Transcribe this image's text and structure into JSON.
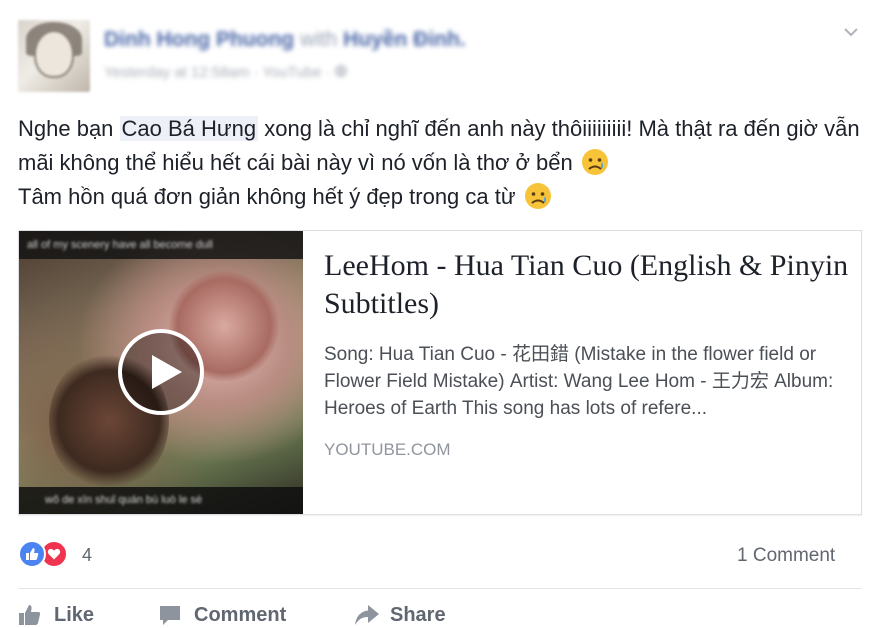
{
  "header": {
    "author": "Dinh Hong Phuong",
    "with_label": "with",
    "tagged": "Huyền Đinh.",
    "timestamp": "Yesterday at 12:58am",
    "source": "YouTube",
    "privacy_icon": "globe-icon",
    "menu_icon": "chevron-down-icon"
  },
  "post": {
    "text_before_mention": "Nghe bạn ",
    "mention": "Cao Bá Hưng",
    "text_line1_rest": " xong là chỉ nghĩ đến anh này thôiiiiiiiii! Mà thật ra đến giờ vẫn mãi không thể hiểu hết cái bài này vì nó vốn là thơ ở bển",
    "text_line2": "Tâm hồn quá đơn giản không hết ý đẹp trong ca từ",
    "emoji": "sad-tear-emoji"
  },
  "link_preview": {
    "thumb_caption_top": "all of my scenery have all become dull",
    "thumb_caption_bottom": "wǒ de xīn shuǐ quán bù luò le sè",
    "title": "LeeHom - Hua Tian Cuo (English & Pinyin Subtitles)",
    "description": "Song: Hua Tian Cuo - 花田錯 (Mistake in the flower field or Flower Field Mistake) Artist: Wang Lee Hom - 王力宏 Album: Heroes of Earth This song has lots of refere...",
    "domain": "YOUTUBE.COM",
    "play_icon": "play-icon"
  },
  "stats": {
    "reaction_count": "4",
    "comment_count": "1 Comment",
    "like_color": "#4b83f1",
    "love_color": "#f0334e"
  },
  "actions": {
    "like": "Like",
    "comment": "Comment",
    "share": "Share"
  }
}
